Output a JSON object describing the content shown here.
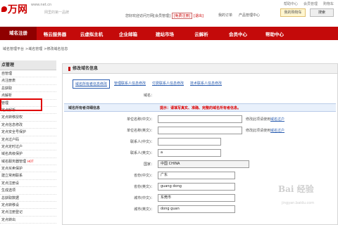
{
  "header": {
    "logo_text": "万网",
    "url": "www.net.cn",
    "slogan": "网里的第一品牌",
    "welcome": "您好欢迎访问万网[会员管理]",
    "free_reg": "[免费注册]",
    "exit": "[退出]",
    "nav": [
      "我的订单",
      "产品管理中心"
    ],
    "links": [
      "帮助中心",
      "会员管理",
      "购物车"
    ],
    "cart": "我的购物车",
    "search_button": "搜索"
  },
  "mainnav": [
    "域名注册",
    "畅云服务器",
    "云虚拟主机",
    "企业邮箱",
    "建站市场",
    "云解析",
    "会员中心",
    "帮助中心"
  ],
  "breadcrumb": [
    "域名管理平台",
    ">域名管理",
    ">修改域名信息"
  ],
  "sidebar": {
    "title": "点管理",
    "items": [
      "自管理",
      "点注册表",
      "总获取",
      "点解析",
      "管理",
      "定点解析",
      "定点转移授权",
      "定点信息修改",
      "定点安全号保护",
      "定点过户码",
      "定点定时过户",
      "域名高级保护",
      "域名服务器管理",
      "定点买卖保护",
      "建立常用联系",
      "定点注册设",
      "生成选项",
      "总获取数据",
      "定点转移设",
      "定点注册登记",
      "定点转出"
    ],
    "hot_tag": "HOT"
  },
  "panel": {
    "title": "修改域名信息",
    "tabs": [
      "域名所有者信息修改",
      "管理联系人信息修改",
      "付费联系人信息修改",
      "技术联系人信息修改"
    ],
    "domain_label": "域名：",
    "section_title": "域名所有者详细信息",
    "warning": "提示：请填写真实、准确、完整的域名所有者信息。",
    "fields": [
      {
        "label": "单位名称(中文)：",
        "value": "",
        "hint": "修改此项请使用",
        "hint_link": "域名过户"
      },
      {
        "label": "单位名称(英文)：",
        "value": "",
        "hint": "修改此项请使用",
        "hint_link": "域名过户"
      },
      {
        "label": "联系人(中文)：",
        "value": "",
        "hint": "",
        "hint_link": ""
      },
      {
        "label": "联系人(英文)：",
        "value": "a",
        "hint": "",
        "hint_link": ""
      },
      {
        "label": "国家：",
        "value": "中国 CHINA",
        "hint": "",
        "hint_link": ""
      },
      {
        "label": "省份(中文)：",
        "value": "广东",
        "hint": "",
        "hint_link": ""
      },
      {
        "label": "省份(英文)：",
        "value": "guang dong",
        "hint": "",
        "hint_link": ""
      },
      {
        "label": "城市(中文)：",
        "value": "东莞市",
        "hint": "",
        "hint_link": ""
      },
      {
        "label": "城市(英文)：",
        "value": "dong guan",
        "hint": "",
        "hint_link": ""
      }
    ]
  },
  "watermark": "Bai 经验",
  "watermark_sub": "jingyan.baidu.com"
}
